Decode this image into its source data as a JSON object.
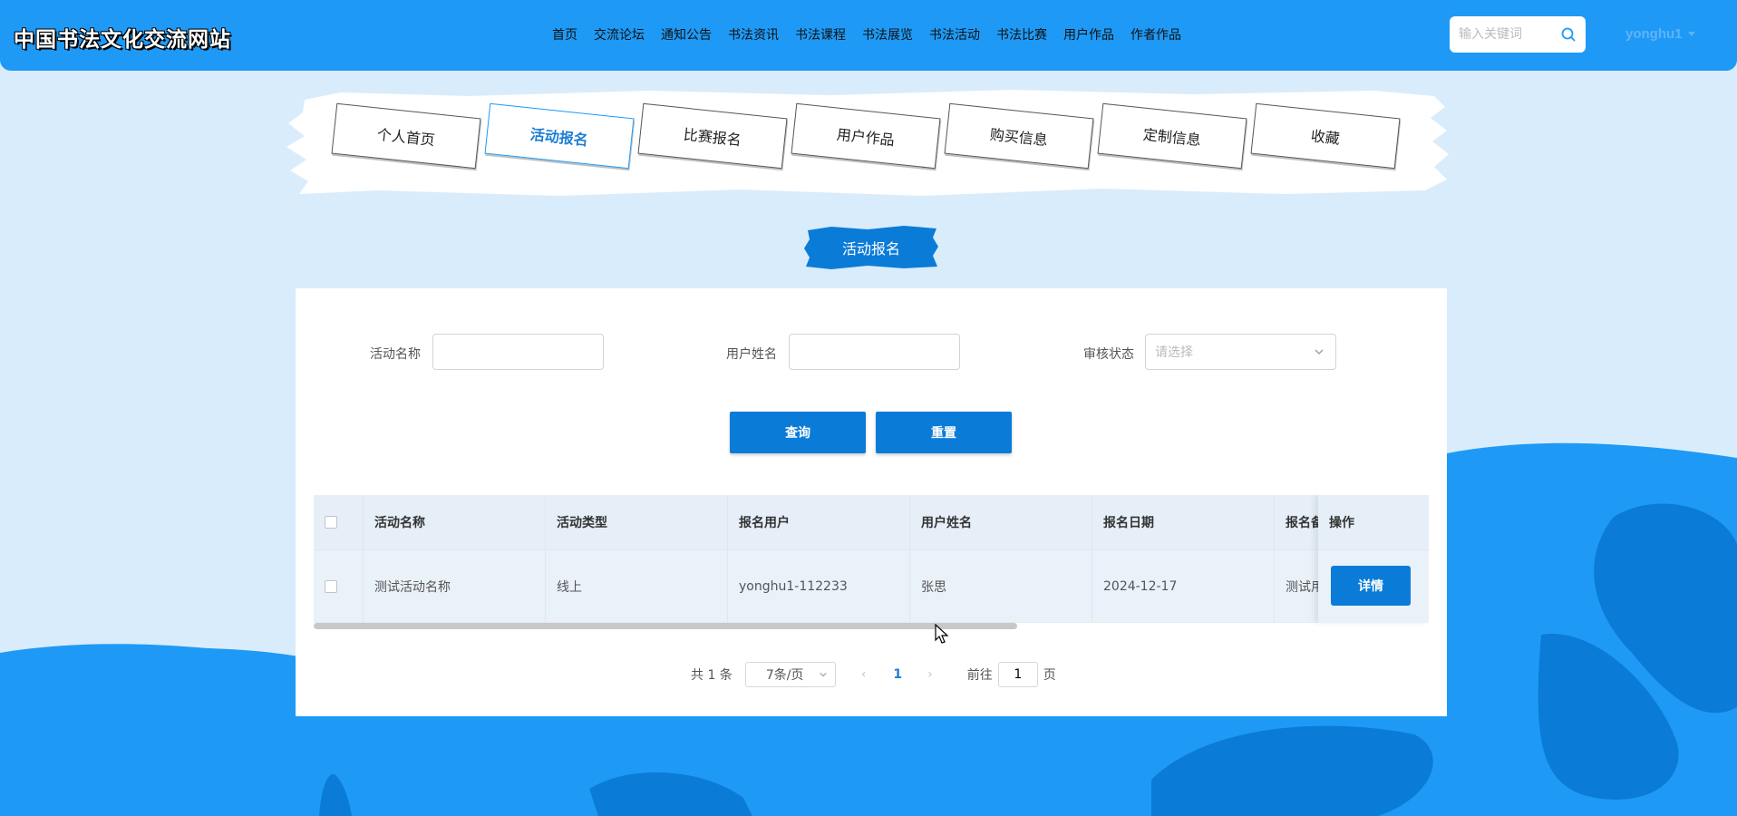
{
  "header": {
    "site_title": "中国书法文化交流网站",
    "nav": [
      "首页",
      "交流论坛",
      "通知公告",
      "书法资讯",
      "书法课程",
      "书法展览",
      "书法活动",
      "书法比赛",
      "用户作品",
      "作者作品"
    ],
    "search_placeholder": "输入关键词",
    "username": "yonghu1"
  },
  "tabs": {
    "items": [
      "个人首页",
      "活动报名",
      "比赛报名",
      "用户作品",
      "购买信息",
      "定制信息",
      "收藏"
    ],
    "active_index": 1
  },
  "section": {
    "title": "活动报名"
  },
  "filters": {
    "activity_name_label": "活动名称",
    "activity_name_value": "",
    "user_name_label": "用户姓名",
    "user_name_value": "",
    "review_status_label": "审核状态",
    "review_status_placeholder": "请选择",
    "query_label": "查询",
    "reset_label": "重置"
  },
  "table": {
    "columns": [
      "活动名称",
      "活动类型",
      "报名用户",
      "用户姓名",
      "报名日期",
      "报名备"
    ],
    "op_column": "操作",
    "rows": [
      {
        "cells": [
          "测试活动名称",
          "线上",
          "yonghu1-112233",
          "张思",
          "2024-12-17",
          "测试用"
        ],
        "action": "详情"
      }
    ]
  },
  "pagination": {
    "total": "共 1 条",
    "page_size": "7条/页",
    "current_page": "1",
    "goto_prefix": "前往",
    "goto_value": "1",
    "goto_suffix": "页",
    "prev": "‹",
    "next": "›"
  },
  "colors": {
    "header_bg": "#1e9af6",
    "primary_button": "#0b7bd8",
    "page_bg": "#d9ecfb",
    "wave_bg": "#1e9af6",
    "wave_dark": "#0b7bd8"
  }
}
